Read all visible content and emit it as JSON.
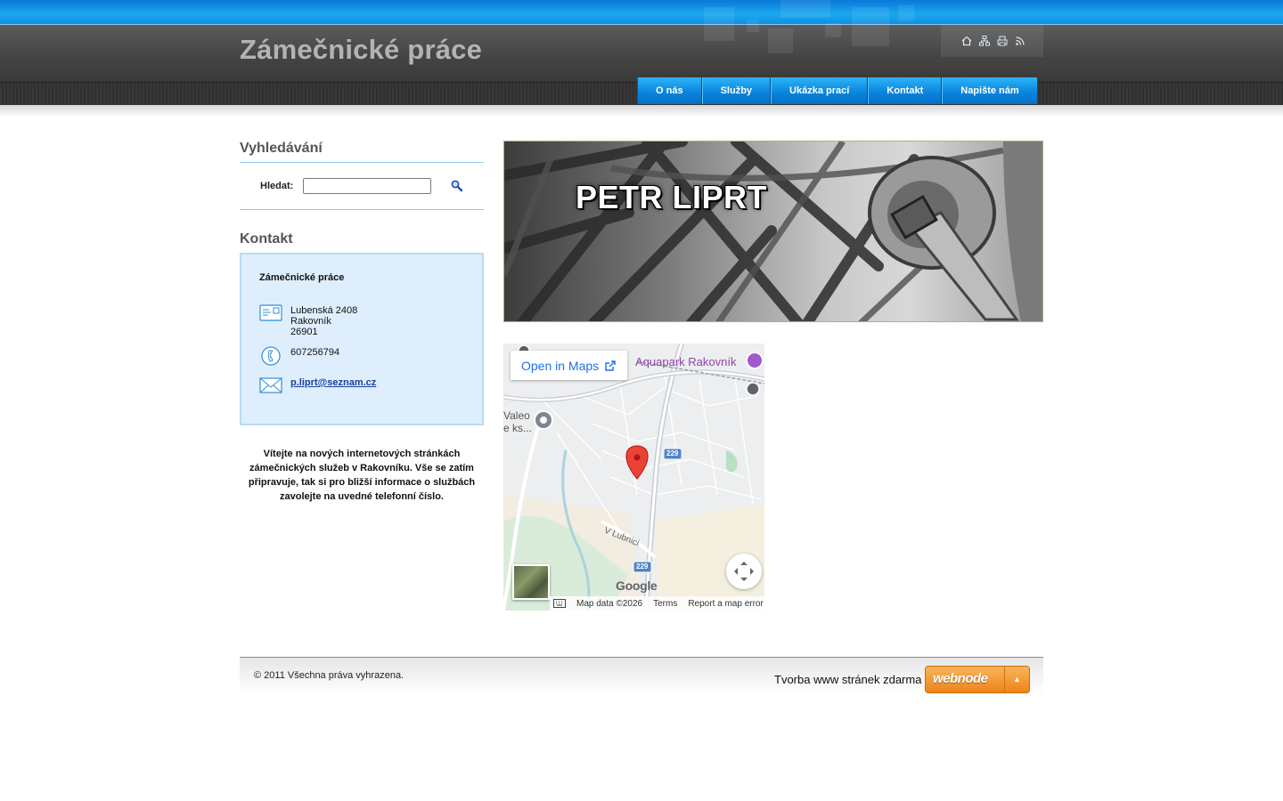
{
  "header": {
    "site_title": "Zámečnické práce",
    "tool_icons": [
      "home-icon",
      "sitemap-icon",
      "print-icon",
      "rss-icon"
    ]
  },
  "nav": {
    "items": [
      {
        "label": "O nás"
      },
      {
        "label": "Služby"
      },
      {
        "label": "Ukázka prací"
      },
      {
        "label": "Kontakt"
      },
      {
        "label": "Napište nám"
      }
    ]
  },
  "search": {
    "heading": "Vyhledávání",
    "label": "Hledat:",
    "value": "",
    "placeholder": ""
  },
  "contact": {
    "heading": "Kontakt",
    "company": "Zámečnické práce",
    "address_line1": "Lubenská 2408",
    "address_line2": "Rakovník",
    "address_line3": "26901",
    "phone": "607256794",
    "email": "p.liprt@seznam.cz"
  },
  "welcome_text": "Vítejte na nových internetových stránkách zámečnických služeb v Rakovníku. Vše se zatím připravuje, tak si pro bližší informace o službách zavolejte na uvedné telefonní číslo.",
  "banner": {
    "text": "PETR LIPRT"
  },
  "map": {
    "open_in_maps": "Open in Maps",
    "place_label": "Aquapark Rakovník",
    "place_label_left": "Valeo",
    "place_label_left2": "e ks...",
    "street_label": "V Lubnici",
    "road_number_1": "229",
    "road_number_2": "229",
    "google_logo": "Google",
    "map_data": "Map data ©2026",
    "terms": "Terms",
    "report": "Report a map error"
  },
  "footer": {
    "copyright": "© 2011 Všechna práva vyhrazena.",
    "link_text": "Tvorba www stránek zdarma",
    "badge_text": "webnode"
  },
  "colors": {
    "nav_blue": "#0a86de",
    "top_strip": "#19a9ef",
    "contact_box": "#dfeefc",
    "webnode_orange": "#ee8418",
    "map_pin": "#ea4335",
    "link_blue": "#1a3fa0"
  }
}
